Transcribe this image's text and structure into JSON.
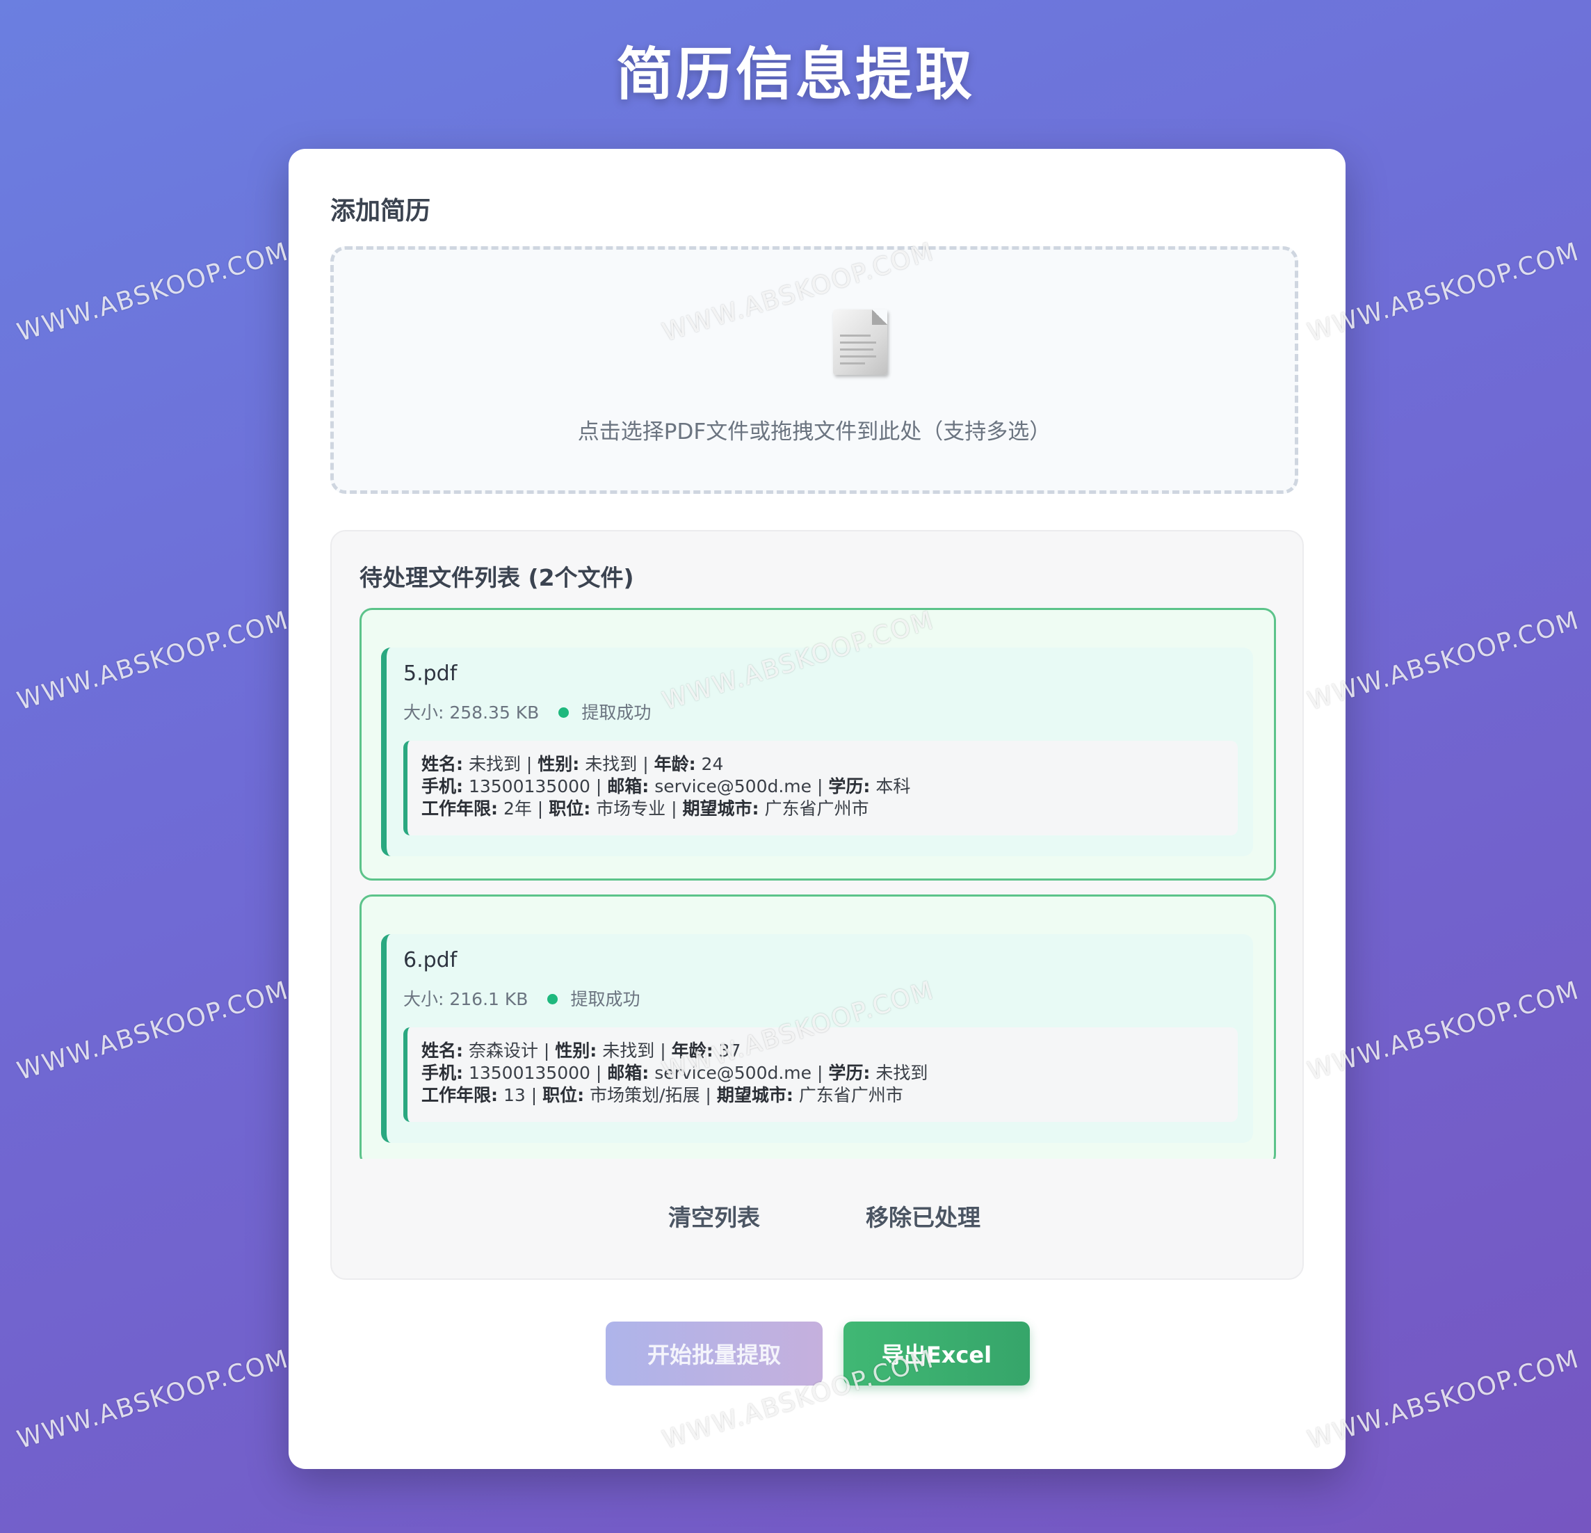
{
  "header": {
    "title": "简历信息提取"
  },
  "upload": {
    "section_title": "添加简历",
    "hint": "点击选择PDF文件或拖拽文件到此处（支持多选）",
    "icon": "document-icon"
  },
  "file_list": {
    "title": "待处理文件列表 (2个文件)",
    "files": [
      {
        "name": "5.pdf",
        "size": "大小: 258.35 KB",
        "status": "提取成功",
        "status_color": "#1eb87d",
        "lines": [
          [
            {
              "label": "姓名:",
              "value": "未找到"
            },
            {
              "label": "性别:",
              "value": "未找到"
            },
            {
              "label": "年龄:",
              "value": "24"
            }
          ],
          [
            {
              "label": "手机:",
              "value": "13500135000"
            },
            {
              "label": "邮箱:",
              "value": "service@500d.me"
            },
            {
              "label": "学历:",
              "value": "本科"
            }
          ],
          [
            {
              "label": "工作年限:",
              "value": "2年"
            },
            {
              "label": "职位:",
              "value": "市场专业"
            },
            {
              "label": "期望城市:",
              "value": "广东省广州市"
            }
          ]
        ]
      },
      {
        "name": "6.pdf",
        "size": "大小: 216.1 KB",
        "status": "提取成功",
        "status_color": "#1eb87d",
        "lines": [
          [
            {
              "label": "姓名:",
              "value": "奈森设计"
            },
            {
              "label": "性别:",
              "value": "未找到"
            },
            {
              "label": "年龄:",
              "value": "37"
            }
          ],
          [
            {
              "label": "手机:",
              "value": "13500135000"
            },
            {
              "label": "邮箱:",
              "value": "service@500d.me"
            },
            {
              "label": "学历:",
              "value": "未找到"
            }
          ],
          [
            {
              "label": "工作年限:",
              "value": "13"
            },
            {
              "label": "职位:",
              "value": "市场策划/拓展"
            },
            {
              "label": "期望城市:",
              "value": "广东省广州市"
            }
          ]
        ]
      }
    ],
    "clear_label": "清空列表",
    "remove_label": "移除已处理"
  },
  "actions": {
    "start_label": "开始批量提取",
    "export_label": "导出Excel"
  },
  "watermark": {
    "text": "WWW.ABSKOOP.COM"
  },
  "colors": {
    "accent_green": "#40b874",
    "card_border_green": "#5cc38a",
    "background_start": "#6b7fe0",
    "background_end": "#7656c1"
  }
}
